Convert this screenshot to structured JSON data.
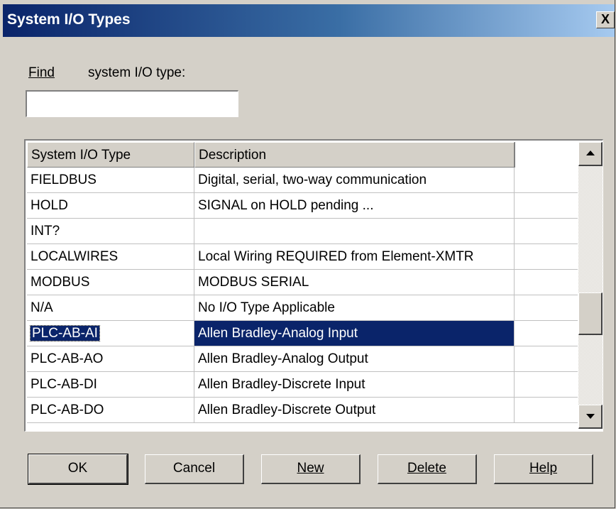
{
  "window": {
    "title": "System I/O Types",
    "close_glyph": "X"
  },
  "find": {
    "label": "Find",
    "hint": "system I/O type:",
    "value": ""
  },
  "table": {
    "columns": [
      "System I/O Type",
      "Description"
    ],
    "rows": [
      {
        "type": "FIELDBUS",
        "description": "Digital, serial, two-way communication"
      },
      {
        "type": "HOLD",
        "description": "SIGNAL on HOLD pending ..."
      },
      {
        "type": "INT?",
        "description": ""
      },
      {
        "type": "LOCALWIRES",
        "description": "Local Wiring REQUIRED from Element-XMTR"
      },
      {
        "type": "MODBUS",
        "description": "MODBUS SERIAL"
      },
      {
        "type": "N/A",
        "description": "No I/O Type Applicable"
      },
      {
        "type": "PLC-AB-AI",
        "description": "Allen Bradley-Analog Input"
      },
      {
        "type": "PLC-AB-AO",
        "description": "Allen Bradley-Analog Output"
      },
      {
        "type": "PLC-AB-DI",
        "description": "Allen Bradley-Discrete Input"
      },
      {
        "type": "PLC-AB-DO",
        "description": "Allen Bradley-Discrete Output"
      }
    ],
    "selected_index": 6
  },
  "buttons": {
    "ok": "OK",
    "cancel": "Cancel",
    "new": "New",
    "delete": "Delete",
    "help": "Help"
  },
  "colors": {
    "selection": "#0a246a",
    "title_start": "#0a246a",
    "title_end": "#a6caf0",
    "dialog_bg": "#d4d0c8"
  }
}
